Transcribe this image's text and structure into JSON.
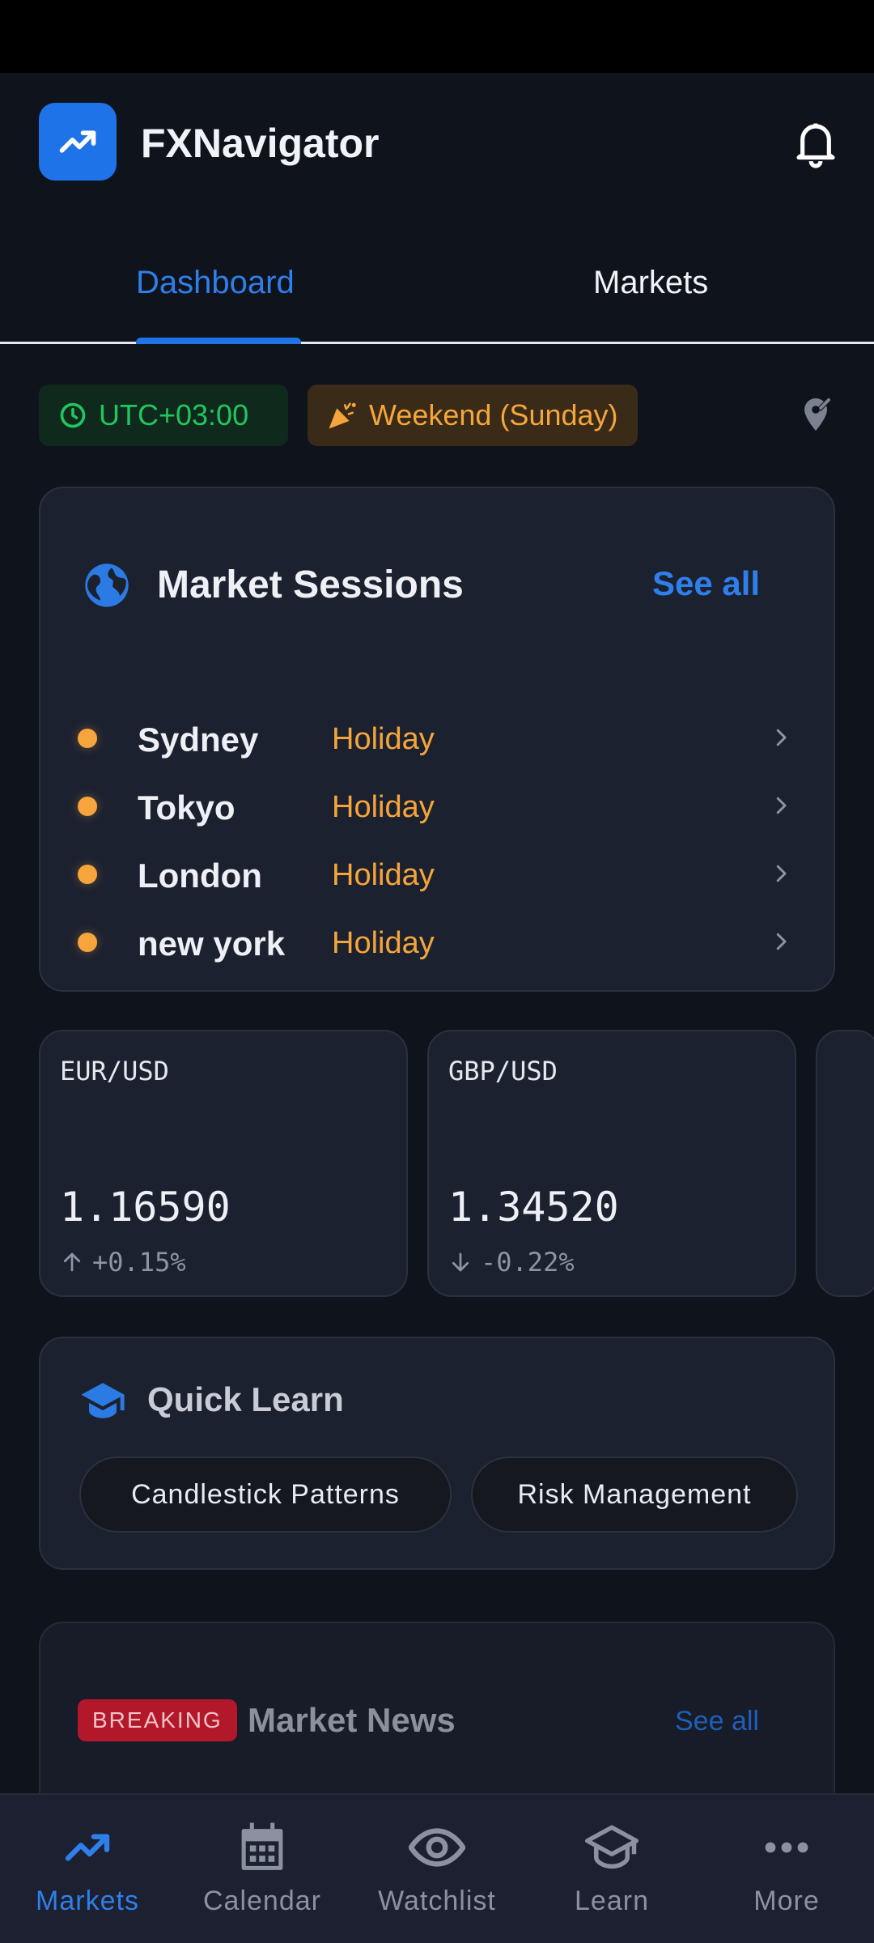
{
  "app": {
    "title": "FXNavigator"
  },
  "tabs": [
    {
      "label": "Dashboard",
      "active": true
    },
    {
      "label": "Markets",
      "active": false
    }
  ],
  "chips": {
    "timezone": "UTC+03:00",
    "status": "Weekend (Sunday)"
  },
  "sessions": {
    "title": "Market Sessions",
    "see_all": "See all",
    "rows": [
      {
        "name": "Sydney",
        "status": "Holiday"
      },
      {
        "name": "Tokyo",
        "status": "Holiday"
      },
      {
        "name": "London",
        "status": "Holiday"
      },
      {
        "name": "new york",
        "status": "Holiday"
      }
    ]
  },
  "pairs": [
    {
      "name": "EUR/USD",
      "price": "1.16590",
      "change": "+0.15%",
      "direction": "up"
    },
    {
      "name": "GBP/USD",
      "price": "1.34520",
      "change": "-0.22%",
      "direction": "down"
    }
  ],
  "learn": {
    "title": "Quick Learn",
    "topics": [
      "Candlestick Patterns",
      "Risk Management"
    ]
  },
  "news": {
    "badge": "BREAKING",
    "title": "Market News",
    "see_all": "See all"
  },
  "nav": [
    {
      "label": "Markets",
      "icon": "trending-up-icon",
      "active": true
    },
    {
      "label": "Calendar",
      "icon": "calendar-icon",
      "active": false
    },
    {
      "label": "Watchlist",
      "icon": "eye-icon",
      "active": false
    },
    {
      "label": "Learn",
      "icon": "graduation-cap-icon",
      "active": false
    },
    {
      "label": "More",
      "icon": "more-dots-icon",
      "active": false
    }
  ],
  "colors": {
    "accent": "#2f7fea",
    "holiday": "#f5a53b",
    "success": "#22c55e",
    "breaking": "#b3172a"
  }
}
